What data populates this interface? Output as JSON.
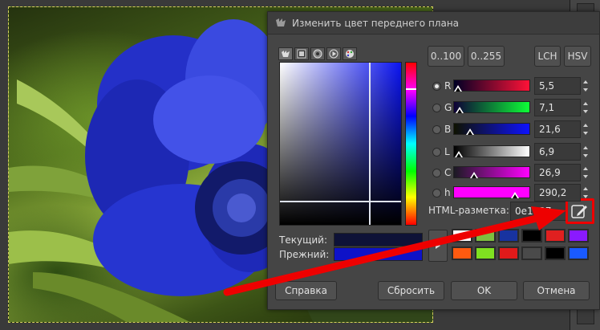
{
  "dialog": {
    "title": "Изменить цвет переднего плана",
    "range_buttons": [
      "0..100",
      "0..255"
    ],
    "model_buttons": [
      "LCH",
      "HSV"
    ],
    "channels": [
      {
        "label": "R",
        "value": "5,5",
        "selected": true,
        "level": 0.055
      },
      {
        "label": "G",
        "value": "7,1",
        "selected": false,
        "level": 0.071
      },
      {
        "label": "B",
        "value": "21,6",
        "selected": false,
        "level": 0.216
      },
      {
        "label": "L",
        "value": "6,9",
        "selected": false,
        "level": 0.069
      },
      {
        "label": "C",
        "value": "26,9",
        "selected": false,
        "level": 0.269
      },
      {
        "label": "h",
        "value": "290,2",
        "selected": false,
        "level": 0.806
      }
    ],
    "html_label": "HTML-разметка:",
    "html_value": "0e1237",
    "current_label": "Текущий:",
    "previous_label": "Прежний:",
    "current_color": "#0e1237",
    "previous_color": "#0e12c8",
    "history_colors": [
      "#ffffff",
      "#7fbf3f",
      "#1833a0",
      "#000000",
      "#e02020",
      "#8a1aff",
      "#ff5a10",
      "#7fe020",
      "#e01a1a",
      "#4a4a4a",
      "#000000",
      "#1a5aff"
    ],
    "buttons": {
      "help": "Справка",
      "reset": "Сбросить",
      "ok": "OK",
      "cancel": "Отмена"
    }
  },
  "colors": {
    "highlight": "#ee0000",
    "dialog_bg": "#454545"
  }
}
